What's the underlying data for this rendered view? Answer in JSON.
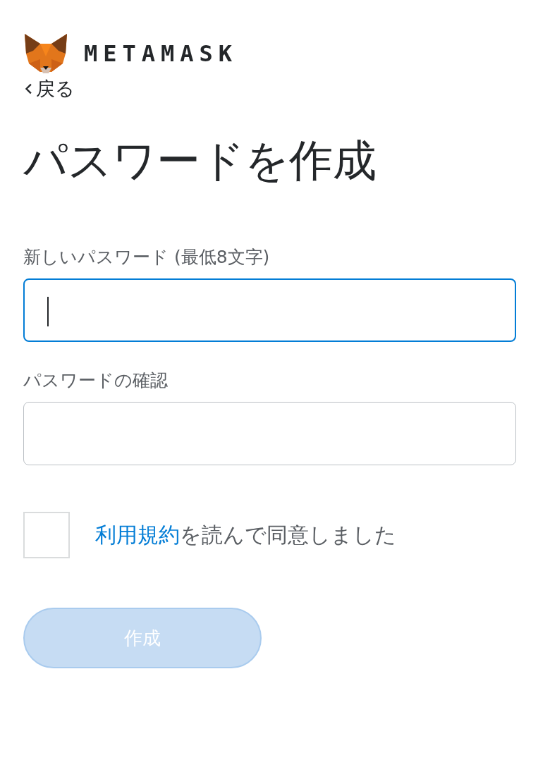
{
  "logo": {
    "text": "METAMASK"
  },
  "back": {
    "label": "戻る"
  },
  "title": "パスワードを作成",
  "fields": [
    {
      "label": "新しいパスワード (最低8文字)",
      "focused": true
    },
    {
      "label": "パスワードの確認",
      "focused": false
    }
  ],
  "terms": {
    "checked": false,
    "link": "利用規約",
    "text": "を読んで同意しました"
  },
  "button": {
    "label": "作成",
    "disabled": true
  }
}
